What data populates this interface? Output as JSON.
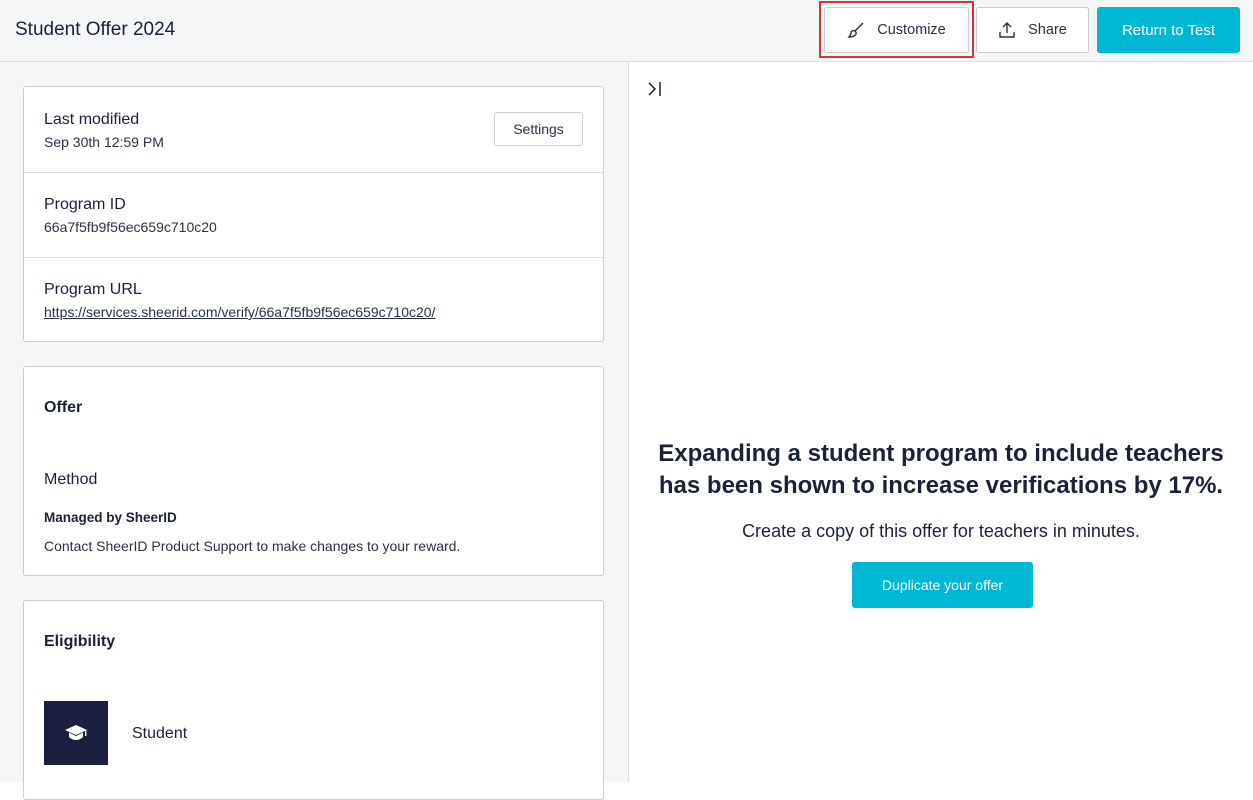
{
  "header": {
    "title": "Student Offer 2024",
    "customize_label": "Customize",
    "share_label": "Share",
    "return_label": "Return to Test"
  },
  "details": {
    "last_modified_label": "Last modified",
    "last_modified_value": "Sep 30th 12:59 PM",
    "settings_label": "Settings",
    "program_id_label": "Program ID",
    "program_id_value": "66a7f5fb9f56ec659c710c20",
    "program_url_label": "Program URL",
    "program_url_value": "https://services.sheerid.com/verify/66a7f5fb9f56ec659c710c20/"
  },
  "offer": {
    "title": "Offer",
    "method_label": "Method",
    "managed_label": "Managed by SheerID",
    "note": "Contact SheerID Product Support to make changes to your reward."
  },
  "eligibility": {
    "title": "Eligibility",
    "segment_label": "Student",
    "segment_icon": "graduation-cap-icon"
  },
  "promo": {
    "headline_line1": "Expanding a student program to include teachers",
    "headline_line2": "has been shown to increase verifications by 17%.",
    "subtext": "Create a copy of this offer for teachers in minutes.",
    "button_label": "Duplicate your offer"
  },
  "colors": {
    "accent": "#00b7d4",
    "highlight": "#d9323a",
    "dark": "#1b2040"
  }
}
